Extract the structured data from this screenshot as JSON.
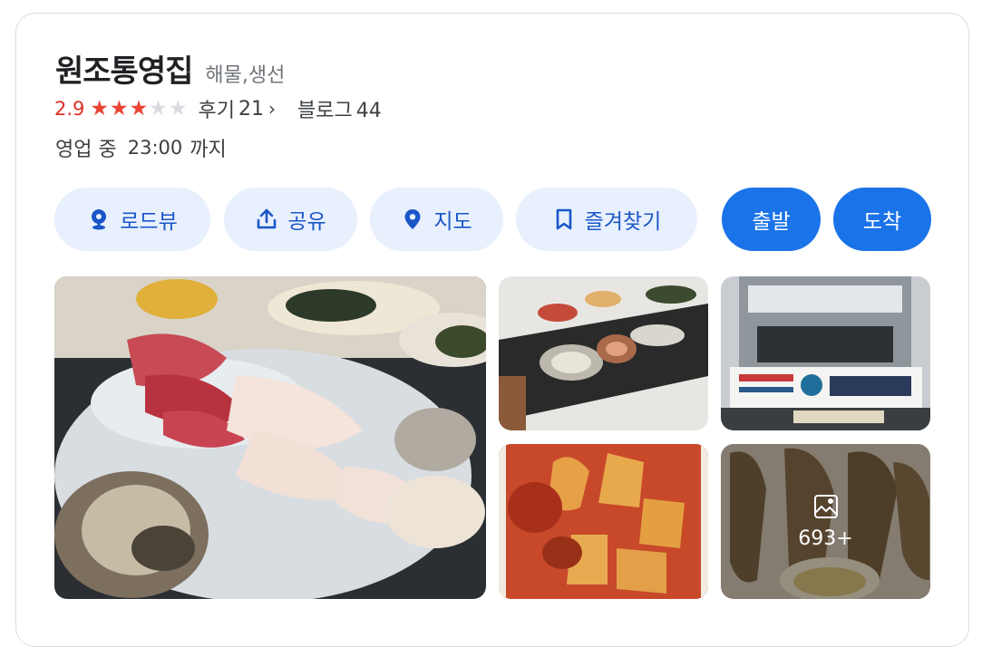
{
  "place": {
    "name": "원조통영집",
    "category": "해물,생선",
    "rating": "2.9",
    "stars_filled": 3,
    "stars_total": 5,
    "review_label": "후기",
    "review_count": "21",
    "blog_label": "블로그",
    "blog_count": "44",
    "status": "영업 중",
    "closing_time": "23:00",
    "closing_suffix": "까지"
  },
  "actions": {
    "roadview": "로드뷰",
    "share": "공유",
    "map": "지도",
    "bookmark": "즐겨찾기",
    "depart": "출발",
    "arrive": "도착"
  },
  "photos": {
    "more_count": "693+"
  },
  "icons": {
    "star": "star-icon",
    "roadview": "roadview-pin-icon",
    "share": "share-icon",
    "map": "map-pin-icon",
    "bookmark": "bookmark-icon",
    "gallery": "gallery-icon"
  },
  "colors": {
    "accent": "#1a73e8",
    "chip_bg": "#e8f0fe",
    "rating_red": "#d93025",
    "star_on": "#ea4335"
  }
}
